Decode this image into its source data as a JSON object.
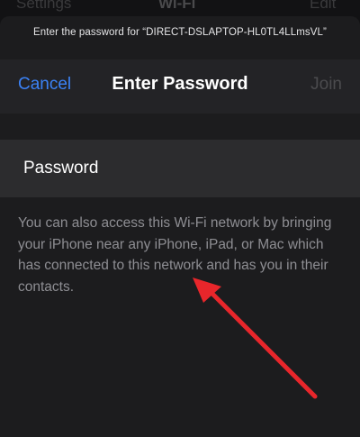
{
  "backdrop": {
    "back_label": "Settings",
    "title": "Wi-Fi",
    "edit_label": "Edit"
  },
  "prompt": "Enter the password for “DIRECT-DSLAPTOP-HL0TL4LLmsVL”",
  "nav": {
    "cancel_label": "Cancel",
    "title": "Enter Password",
    "join_label": "Join"
  },
  "password_field": {
    "placeholder": "Password",
    "value": ""
  },
  "footnote": "You can also access this Wi-Fi network by bringing your iPhone near any iPhone, iPad, or Mac which has connected to this network and has you in their contacts.",
  "annotation": {
    "arrow_color": "#e8262b"
  },
  "colors": {
    "background": "#1c1c1e",
    "nav_background": "#232326",
    "field_background": "#2c2c2e",
    "accent": "#3b82f6",
    "disabled": "#4b4b4e",
    "secondary_text": "#8e8e93"
  }
}
